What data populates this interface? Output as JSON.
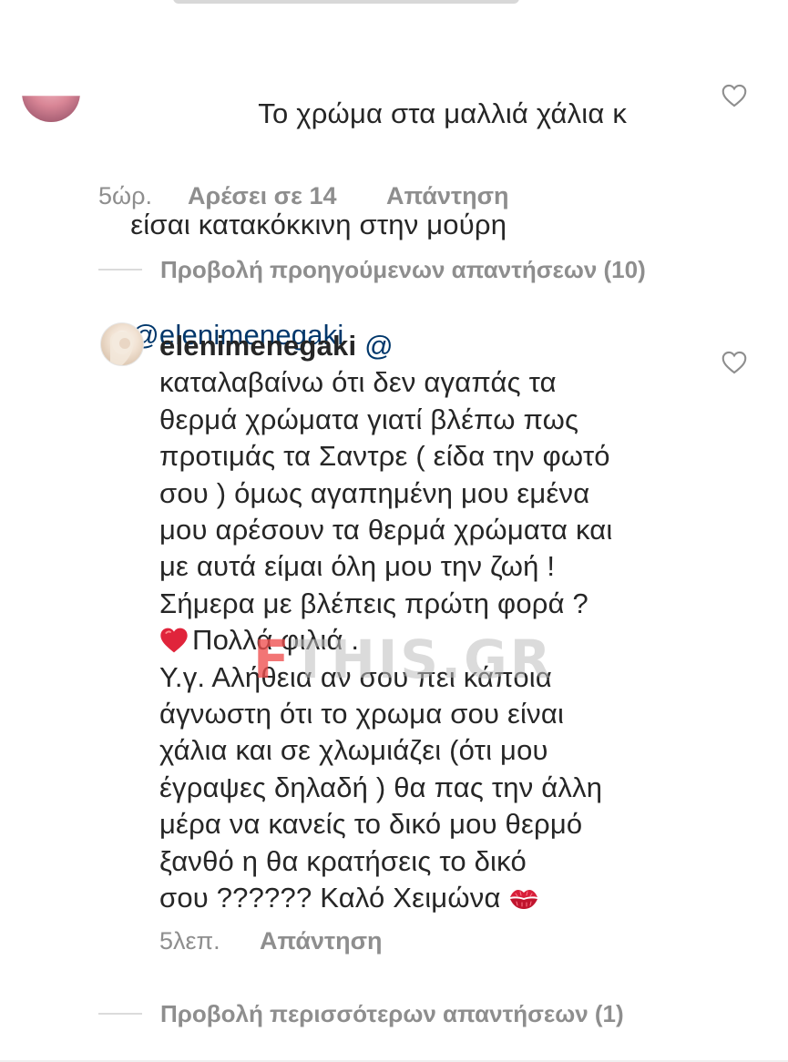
{
  "first_comment": {
    "lines": [
      "Το χρώμα στα μαλλιά χάλια κ",
      "είσαι κατακόκκινη στην μούρη"
    ],
    "mention": "@elenimenegaki",
    "time": "5ώρ.",
    "likes": "Αρέσει σε 14",
    "reply_label": "Απάντηση"
  },
  "view_previous_replies": "Προβολή προηγούμενων απαντήσεων (10)",
  "reply": {
    "username": "elenimenegaki",
    "mention_fragment": "@",
    "lines": [
      "καταλαβαίνω ότι δεν αγαπάς τα",
      "θερμά χρώματα γιατί βλέπω πως",
      "προτιμάς τα Σαντρε ( είδα την φωτό",
      "σου ) όμως αγαπημένη μου εμένα",
      "μου αρέσουν τα θερμά χρώματα και",
      "με αυτά είμαι όλη μου την ζωή !",
      "Σήμερα με βλέπεις πρώτη φορά ?"
    ],
    "heart_line_text": "Πολλά φιλιά .",
    "lines_after": [
      "Υ.γ. Αλήθεια αν σου πει κάποια",
      "άγνωστη ότι το χρωμα σου είναι",
      "χάλια και σε χλωμιάζει (ότι μου",
      "έγραψες δηλαδή ) θα πας την άλλη",
      "μέρα να κανείς το δικό μου θερμό",
      "ξανθό η θα κρατήσεις το δικό"
    ],
    "last_line_text": "σου ?????? Καλό Χειμώνα",
    "time": "5λεπ.",
    "reply_label": "Απάντηση"
  },
  "view_more_replies": "Προβολή περισσότερων απαντήσεων (1)",
  "watermark": {
    "highlight": "F",
    "rest": "THIS.GR"
  },
  "icons": {
    "like": "heart-outline-icon",
    "emoji_heart": "red-heart-emoji",
    "emoji_kiss": "kiss-mark-emoji"
  },
  "colors": {
    "text": "#262626",
    "secondary": "#8e8e8e",
    "mention": "#00376b",
    "heart_emoji": "#e0243b",
    "watermark_accent": "#ee4e4e"
  }
}
